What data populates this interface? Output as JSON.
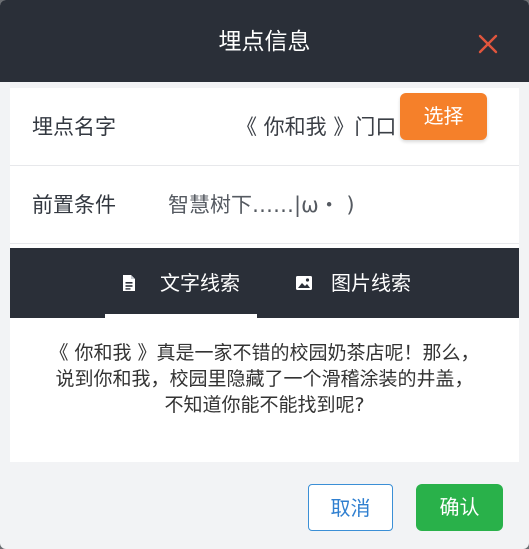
{
  "dialog": {
    "title": "埋点信息",
    "close_icon": "close-icon"
  },
  "fields": {
    "name_label": "埋点名字",
    "name_value": "《 你和我 》门口",
    "condition_label": "前置条件",
    "condition_value": "智慧树下……|ω・ )",
    "select_label": "选择"
  },
  "tabs": [
    {
      "label": "文字线索",
      "icon": "document-icon",
      "active": true
    },
    {
      "label": "图片线索",
      "icon": "image-icon",
      "active": false
    }
  ],
  "clue": {
    "lines": [
      "《 你和我 》真是一家不错的校园奶茶店呢！那么，",
      "说到你和我，校园里隐藏了一个滑稽涂装的井盖，",
      "不知道你能不能找到呢?"
    ]
  },
  "actions": {
    "cancel_label": "取消",
    "confirm_label": "确认"
  },
  "colors": {
    "header_bg": "#2a2f38",
    "select_button": "#f5802a",
    "confirm_button": "#29b14a",
    "cancel_border": "#3b8fd6",
    "close_icon": "#e0553d"
  }
}
